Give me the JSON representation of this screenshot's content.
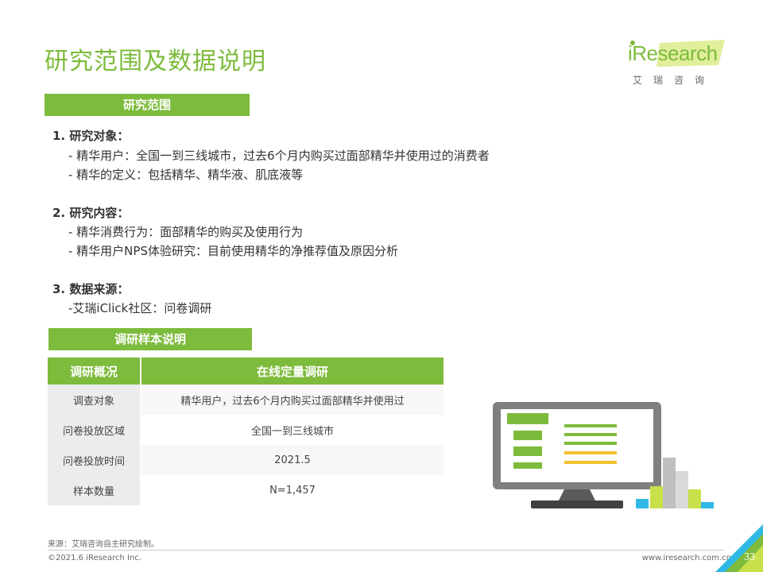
{
  "header": {
    "title": "研究范围及数据说明",
    "logo_text": "iResearch",
    "logo_sub": "艾瑞咨询"
  },
  "research_scope": {
    "bar_label": "研究范围",
    "items": [
      {
        "heading": "1.  研究对象：",
        "lines": [
          "- 精华用户：全国一到三线城市，过去6个月内购买过面部精华并使用过的消费者",
          "- 精华的定义：包括精华、精华液、肌底液等"
        ]
      },
      {
        "heading": "2.  研究内容：",
        "lines": [
          "- 精华消费行为：面部精华的购买及使用行为",
          "- 精华用户NPS体验研究：目前使用精华的净推荐值及原因分析"
        ]
      },
      {
        "heading": "3. 数据来源：",
        "lines": [
          "-艾瑞iClick社区：问卷调研"
        ]
      }
    ]
  },
  "sample": {
    "bar_label": "调研样本说明",
    "table": {
      "headers": [
        "调研概况",
        "在线定量调研"
      ],
      "rows": [
        [
          "调查对象",
          "精华用户，过去6个月内购买过面部精华并使用过"
        ],
        [
          "问卷投放区域",
          "全国一到三线城市"
        ],
        [
          "问卷投放时间",
          "2021.5"
        ],
        [
          "样本数量",
          "N=1,457"
        ]
      ]
    }
  },
  "footer": {
    "source": "来源：艾瑞咨询自主研究绘制。",
    "copyright": "©2021.6 iResearch Inc.",
    "website": "www.iresearch.com.cn",
    "page_number": "33"
  },
  "colors": {
    "accent_green": "#7dbb3c",
    "accent_yellow": "#f2c12e",
    "accent_cyan": "#2fb7e6",
    "gray": "#808080"
  }
}
